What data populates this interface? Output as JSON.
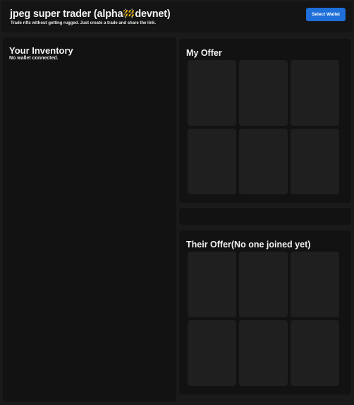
{
  "header": {
    "title_before": "jpeg super trader (alpha",
    "title_after": "devnet)",
    "title_icon": "construction-barrier-icon",
    "subtitle": "Trade nfts without getting rugged. Just create a trade and share the link.",
    "select_wallet_label": "Select Wallet"
  },
  "inventory": {
    "title": "Your Inventory",
    "status": "No wallet connected."
  },
  "my_offer": {
    "title": "My Offer",
    "slot_count": 6
  },
  "their_offer": {
    "title": "Their Offer(No one joined yet)",
    "slot_count": 6
  },
  "colors": {
    "background": "#1a1a1a",
    "panel": "#121212",
    "slot": "#1f1f1f",
    "accent": "#1e6fd9",
    "text": "#f2f2f2"
  }
}
